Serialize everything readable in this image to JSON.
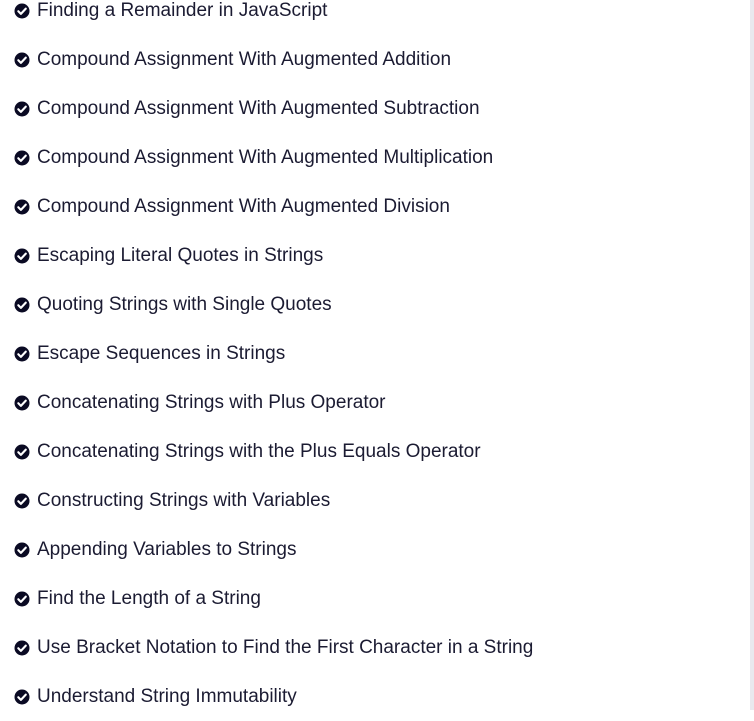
{
  "colors": {
    "text": "#1b1b32",
    "check_icon": "#0a0a23",
    "background": "#ffffff"
  },
  "challenges": {
    "icon": "check-circle-icon",
    "items": [
      {
        "label": "Finding a Remainder in JavaScript",
        "completed": true
      },
      {
        "label": "Compound Assignment With Augmented Addition",
        "completed": true
      },
      {
        "label": "Compound Assignment With Augmented Subtraction",
        "completed": true
      },
      {
        "label": "Compound Assignment With Augmented Multiplication",
        "completed": true
      },
      {
        "label": "Compound Assignment With Augmented Division",
        "completed": true
      },
      {
        "label": "Escaping Literal Quotes in Strings",
        "completed": true
      },
      {
        "label": "Quoting Strings with Single Quotes",
        "completed": true
      },
      {
        "label": "Escape Sequences in Strings",
        "completed": true
      },
      {
        "label": "Concatenating Strings with Plus Operator",
        "completed": true
      },
      {
        "label": "Concatenating Strings with the Plus Equals Operator",
        "completed": true
      },
      {
        "label": "Constructing Strings with Variables",
        "completed": true
      },
      {
        "label": "Appending Variables to Strings",
        "completed": true
      },
      {
        "label": "Find the Length of a String",
        "completed": true
      },
      {
        "label": "Use Bracket Notation to Find the First Character in a String",
        "completed": true
      },
      {
        "label": "Understand String Immutability",
        "completed": true
      }
    ]
  }
}
